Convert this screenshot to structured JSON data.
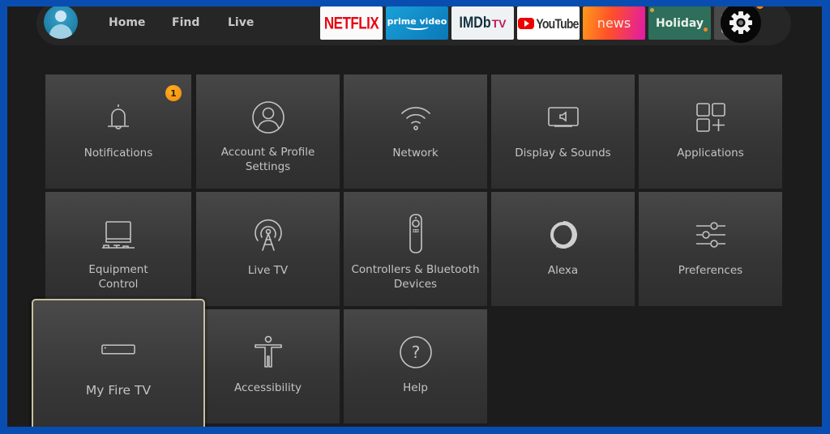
{
  "nav": {
    "links": [
      {
        "label": "Home"
      },
      {
        "label": "Find"
      },
      {
        "label": "Live"
      }
    ],
    "apps": [
      {
        "label": "NETFLIX",
        "brand_color": "#e50914"
      },
      {
        "label": "prime video",
        "brand_color": "#1aa0d8"
      },
      {
        "label": "IMDb",
        "suffix": "TV",
        "brand_color": "#13303f"
      },
      {
        "label": "YouTube",
        "brand_color": "#ee0000"
      },
      {
        "label": "news",
        "brand_color": "#ff4f2a"
      },
      {
        "label": "Holiday",
        "brand_color": "#2e6e5a"
      }
    ],
    "settings_icon": "gear-icon",
    "apps_icon": "apps-plus-icon",
    "profile_icon": "user-avatar-icon"
  },
  "settings": {
    "tiles": [
      {
        "label": "Notifications",
        "icon": "bell-icon",
        "badge": "1"
      },
      {
        "label": "Account & Profile\nSettings",
        "icon": "user-circle-icon"
      },
      {
        "label": "Network",
        "icon": "wifi-icon"
      },
      {
        "label": "Display & Sounds",
        "icon": "display-sound-icon"
      },
      {
        "label": "Applications",
        "icon": "apps-plus-icon"
      },
      {
        "label": "Equipment\nControl",
        "icon": "tv-equipment-icon"
      },
      {
        "label": "Live TV",
        "icon": "antenna-icon"
      },
      {
        "label": "Controllers & Bluetooth\nDevices",
        "icon": "remote-icon"
      },
      {
        "label": "Alexa",
        "icon": "alexa-ring-icon"
      },
      {
        "label": "Preferences",
        "icon": "sliders-icon"
      },
      {
        "label": "My Fire TV",
        "icon": "fire-tv-device-icon",
        "focused": true
      },
      {
        "label": "Accessibility",
        "icon": "accessibility-icon"
      },
      {
        "label": "Help",
        "icon": "help-circle-icon"
      }
    ]
  },
  "colors": {
    "frame": "#0a4db0",
    "focus_border": "#cbbf9f",
    "badge": "#f08a0c"
  }
}
